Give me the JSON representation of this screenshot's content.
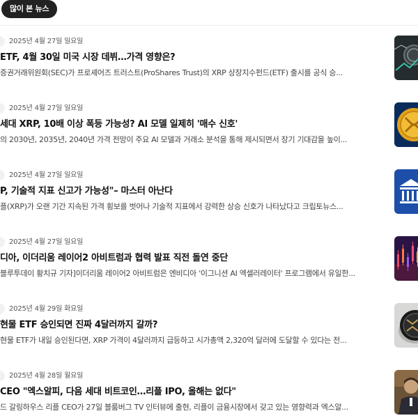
{
  "tab": {
    "label": "많이 본 뉴스"
  },
  "news": [
    {
      "date": "2025년 4월 27일 일요일",
      "headline": "ETF, 4월 30일 미국 시장 데뷔…가격 영향은?",
      "summary": "증권거래위원회(SEC)가 프로셰어즈 트러스트(ProShares Trust)의 XRP 상장지수펀드(ETF) 출시를 공식 승...",
      "thumb": "crypto-coins-dark"
    },
    {
      "date": "2025년 4월 27일 일요일",
      "headline": "세대 XRP, 10배 이상 폭등 가능성? AI 모델 일제히 '매수 신호'",
      "summary": "의 2030년, 2035년, 2040년 가격 전망이 주요 AI 모델과 거래소 분석을 통해 제시되면서 장기 기대감을 높이...",
      "thumb": "gold-coin-blue"
    },
    {
      "date": "2025년 4월 27일 일요일",
      "headline": "P, 기술적 지표 신고가 가능성\"– 마스터 아난다",
      "summary": "플(XRP)가 오랜 기간 지속된 가격 횡보를 벗어나 기술적 지표에서 강력한 상승 신호가 나타났다고 크립토뉴스...",
      "thumb": "bank-icon-blue"
    },
    {
      "date": "2025년 4월 27일 일요일",
      "headline": "디아, 이더리움 레이어2 아비트럼과 협력 발표 직전 돌연 중단",
      "summary": "블루투데이 황치규 기자]이더리움 레이어2 아비트럼은 엔비디아 '이그니션 AI 엑셀러레이터' 프로그램에서 유일한...",
      "thumb": "candle-chart-purple"
    },
    {
      "date": "2025년 4월 29일 화요일",
      "headline": "현물 ETF 승인되면 진짜 4달러까지 갈까?",
      "summary": "현물 ETF가 내일 승인된다면, XRP 가격이 4달러까지 급등하고 시가총액 2,320억 달러에 도달할 수 있다는 전...",
      "thumb": "black-coin-gray"
    },
    {
      "date": "2025년 4월 28일 월요일",
      "headline": "CEO \"엑스알피, 다음 세대 비트코인…리플 IPO, 올해는 없다\"",
      "summary": "드 갈링하우스 리플 CEO가 27일 블룸버그 TV 인터뷰에 출현, 리플이 금융시장에서 갖고 있는 영향력과 엑스알...",
      "thumb": "person-photo"
    }
  ]
}
